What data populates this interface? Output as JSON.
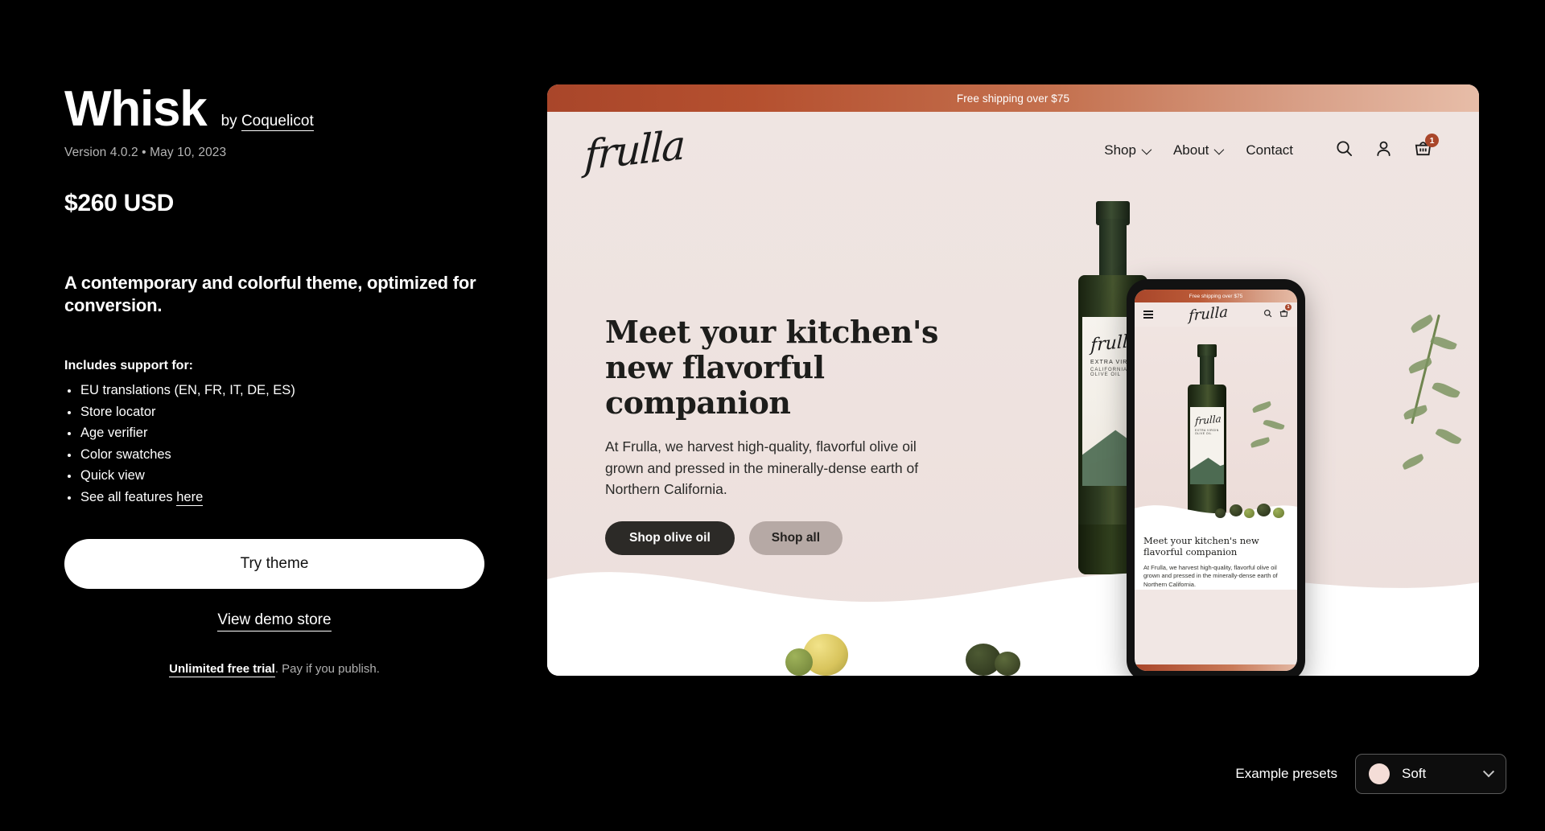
{
  "theme": {
    "name": "Whisk",
    "by_label": "by",
    "vendor": "Coquelicot",
    "version_line": "Version 4.0.2 • May 10, 2023",
    "price": "$260 USD",
    "description": "A contemporary and colorful theme, optimized for conversion.",
    "includes_heading": "Includes support for:",
    "features": [
      {
        "text": "EU translations (EN, FR, IT, DE, ES)",
        "link": ""
      },
      {
        "text": "Store locator",
        "link": ""
      },
      {
        "text": "Age verifier",
        "link": ""
      },
      {
        "text": "Color swatches",
        "link": ""
      },
      {
        "text": "Quick view",
        "link": ""
      },
      {
        "text": "See all features ",
        "link": "here"
      }
    ],
    "try_button": "Try theme",
    "demo_link": "View demo store",
    "trial_strong": "Unlimited free trial",
    "trial_rest": ". Pay if you publish."
  },
  "presets": {
    "label": "Example presets",
    "selected": "Soft",
    "swatch_color": "#f4ddd7"
  },
  "preview": {
    "announcement": "Free shipping over $75",
    "logo": "frulla",
    "nav": [
      {
        "label": "Shop",
        "has_dropdown": true
      },
      {
        "label": "About",
        "has_dropdown": true
      },
      {
        "label": "Contact",
        "has_dropdown": false
      }
    ],
    "cart_count": "1",
    "hero": {
      "title": "Meet your kitchen's new flavorful companion",
      "body": "At Frulla, we harvest high-quality, flavorful olive oil grown and pressed in the minerally-dense earth of Northern California.",
      "primary_button": "Shop olive oil",
      "secondary_button": "Shop all"
    },
    "bottle_label": {
      "logo": "frulla",
      "line1": "EXTRA VIRGIN",
      "line2": "CALIFORNIA OLIVE OIL"
    },
    "mobile": {
      "announcement": "Free shipping over $75",
      "logo": "frulla",
      "cart_count": "1",
      "title": "Meet your kitchen's new flavorful companion",
      "body": "At Frulla, we harvest high-quality, flavorful olive oil grown and pressed in the minerally-dense earth of Northern California.",
      "label_logo": "frulla",
      "label_sub": "EXTRA VIRGIN OLIVE OIL"
    }
  },
  "colors": {
    "accent_brown": "#a9462a",
    "hero_bg": "#efe5e2",
    "dark_button": "#2c2a27",
    "muted_button": "#b6a9a5"
  }
}
